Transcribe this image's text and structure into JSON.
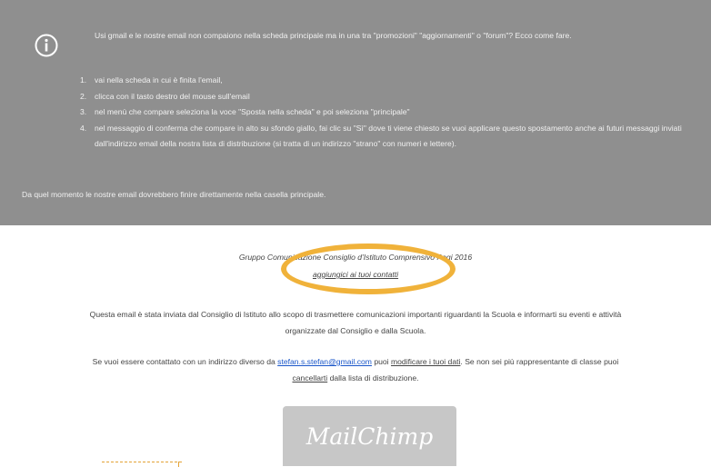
{
  "notice": {
    "icon": "info-circle-icon",
    "intro": "Usi gmail e le nostre email non compaiono nella scheda principale ma in una tra \"promozioni\" \"aggiornamenti\" o \"forum\"? Ecco come fare.",
    "steps": [
      {
        "num": "1.",
        "text": "vai nella scheda in cui è finita l'email,"
      },
      {
        "num": "2.",
        "text": "clicca con il tasto destro del mouse sull'email"
      },
      {
        "num": "3.",
        "text": "nel menù che compare seleziona la voce \"Sposta nella scheda\" e poi seleziona \"principale\""
      },
      {
        "num": "4.",
        "text": "nel messaggio di conferma che compare  in alto su sfondo giallo, fai clic su \"Sì\" dove ti viene chiesto se vuoi applicare questo spostamento anche ai futuri messaggi inviati dall'indirizzo email della nostra lista di distribuzione (si tratta di un indirizzo \"strano\" con numeri e lettere)."
      }
    ],
    "outro": "Da quel momento le nostre email dovrebbero finire direttamente nella casella principale."
  },
  "footer": {
    "gruppo": "Gruppo Comunicazione Consiglio d'Istituto Comprensivo Pagi 2016",
    "aggiungi_link": "aggiungici ai tuoi contatti",
    "p1_line1": "Questa email è stata inviata dal Consiglio di Istituto allo scopo di trasmettere comunicazioni importanti riguardanti la Scuola e informarti su eventi e attività",
    "p1_line2": "organizzate dal Consiglio e dalla Scuola.",
    "p2_before": "Se vuoi essere contattato con un indirizzo diverso da ",
    "p2_email": "stefan.s.stefan@gmail.com",
    "p2_middle": " puoi ",
    "p2_modify_link": "modificare i tuoi dati",
    "p2_after": ". Se non sei più rappresentante di classe puoi",
    "p2_cancel_link": "cancellarti",
    "p2_end": " dalla lista di distribuzione."
  },
  "mailchimp": {
    "label": "MailChimp"
  },
  "colors": {
    "notice_bg": "#8f8f8f",
    "highlight": "#f0b23a",
    "link": "#1a56c9",
    "badge_bg": "#c7c7c7"
  }
}
